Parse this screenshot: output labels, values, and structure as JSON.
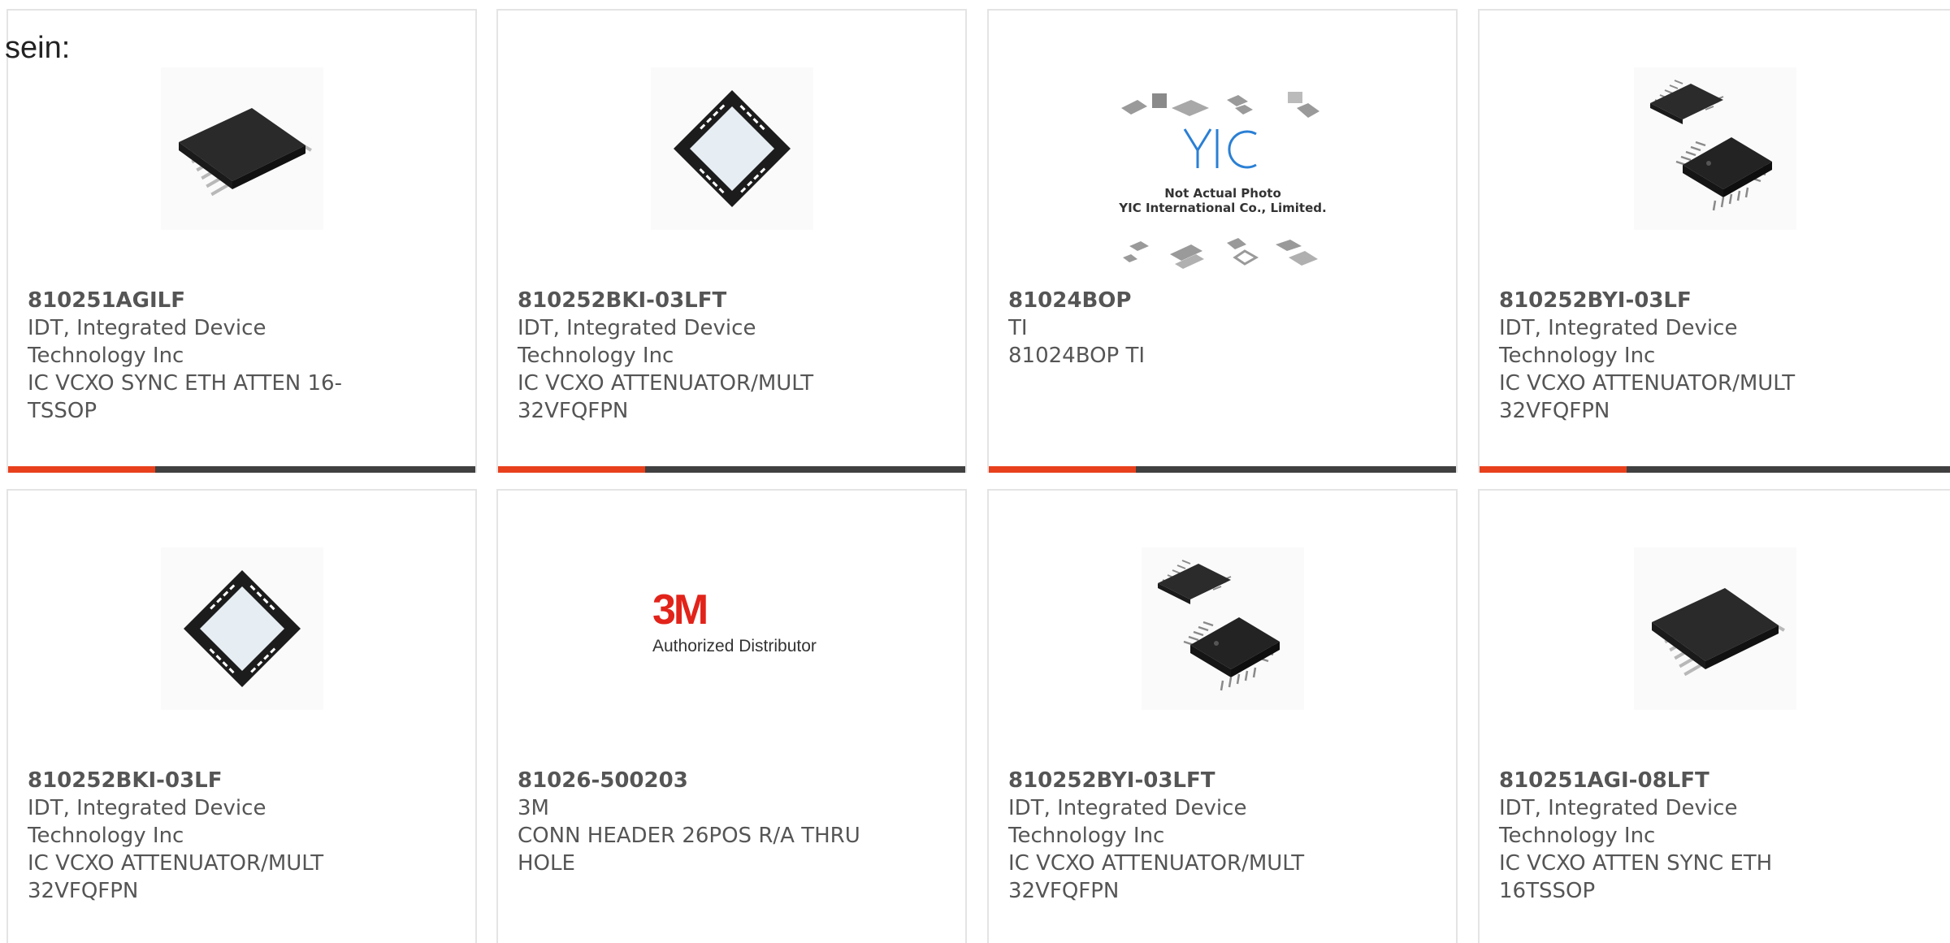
{
  "intro_text": "sein:",
  "colors": {
    "accent": "#e8401c",
    "bar_dark": "#404040",
    "text": "#555555",
    "card_border": "#e4e4e4"
  },
  "products": [
    {
      "part_number": "810251AGILF",
      "manufacturer": "IDT, Integrated Device Technology Inc",
      "description": "IC VCXO SYNC ETH ATTEN 16-TSSOP",
      "image": "tssop-chip-icon"
    },
    {
      "part_number": "810252BKI-03LFT",
      "manufacturer": "IDT, Integrated Device Technology Inc",
      "description": "IC VCXO ATTENUATOR/MULT 32VFQFPN",
      "image": "qfn-chip-icon"
    },
    {
      "part_number": "81024BOP",
      "manufacturer": "TI",
      "description": "81024BOP TI",
      "image": "not-actual-photo-placeholder",
      "placeholder_lines": [
        "Not Actual Photo",
        "YIC International Co., Limited."
      ]
    },
    {
      "part_number": "810252BYI-03LF",
      "manufacturer": "IDT, Integrated Device Technology Inc",
      "description": "IC VCXO ATTENUATOR/MULT 32VFQFPN",
      "image": "qfp-chips-icon"
    },
    {
      "part_number": "810252BKI-03LF",
      "manufacturer": "IDT, Integrated Device Technology Inc",
      "description": "IC VCXO ATTENUATOR/MULT 32VFQFPN",
      "image": "qfn-chip-icon"
    },
    {
      "part_number": "81026-500203",
      "manufacturer": "3M",
      "description": "CONN HEADER 26POS R/A THRU HOLE",
      "image": "3m-logo",
      "logo_text": "3M",
      "logo_caption": "Authorized Distributor"
    },
    {
      "part_number": "810252BYI-03LFT",
      "manufacturer": "IDT, Integrated Device Technology Inc",
      "description": "IC VCXO ATTENUATOR/MULT 32VFQFPN",
      "image": "qfp-chips-icon"
    },
    {
      "part_number": "810251AGI-08LFT",
      "manufacturer": "IDT, Integrated Device Technology Inc",
      "description": "IC VCXO ATTEN SYNC ETH 16TSSOP",
      "image": "tssop-chip-icon"
    }
  ]
}
